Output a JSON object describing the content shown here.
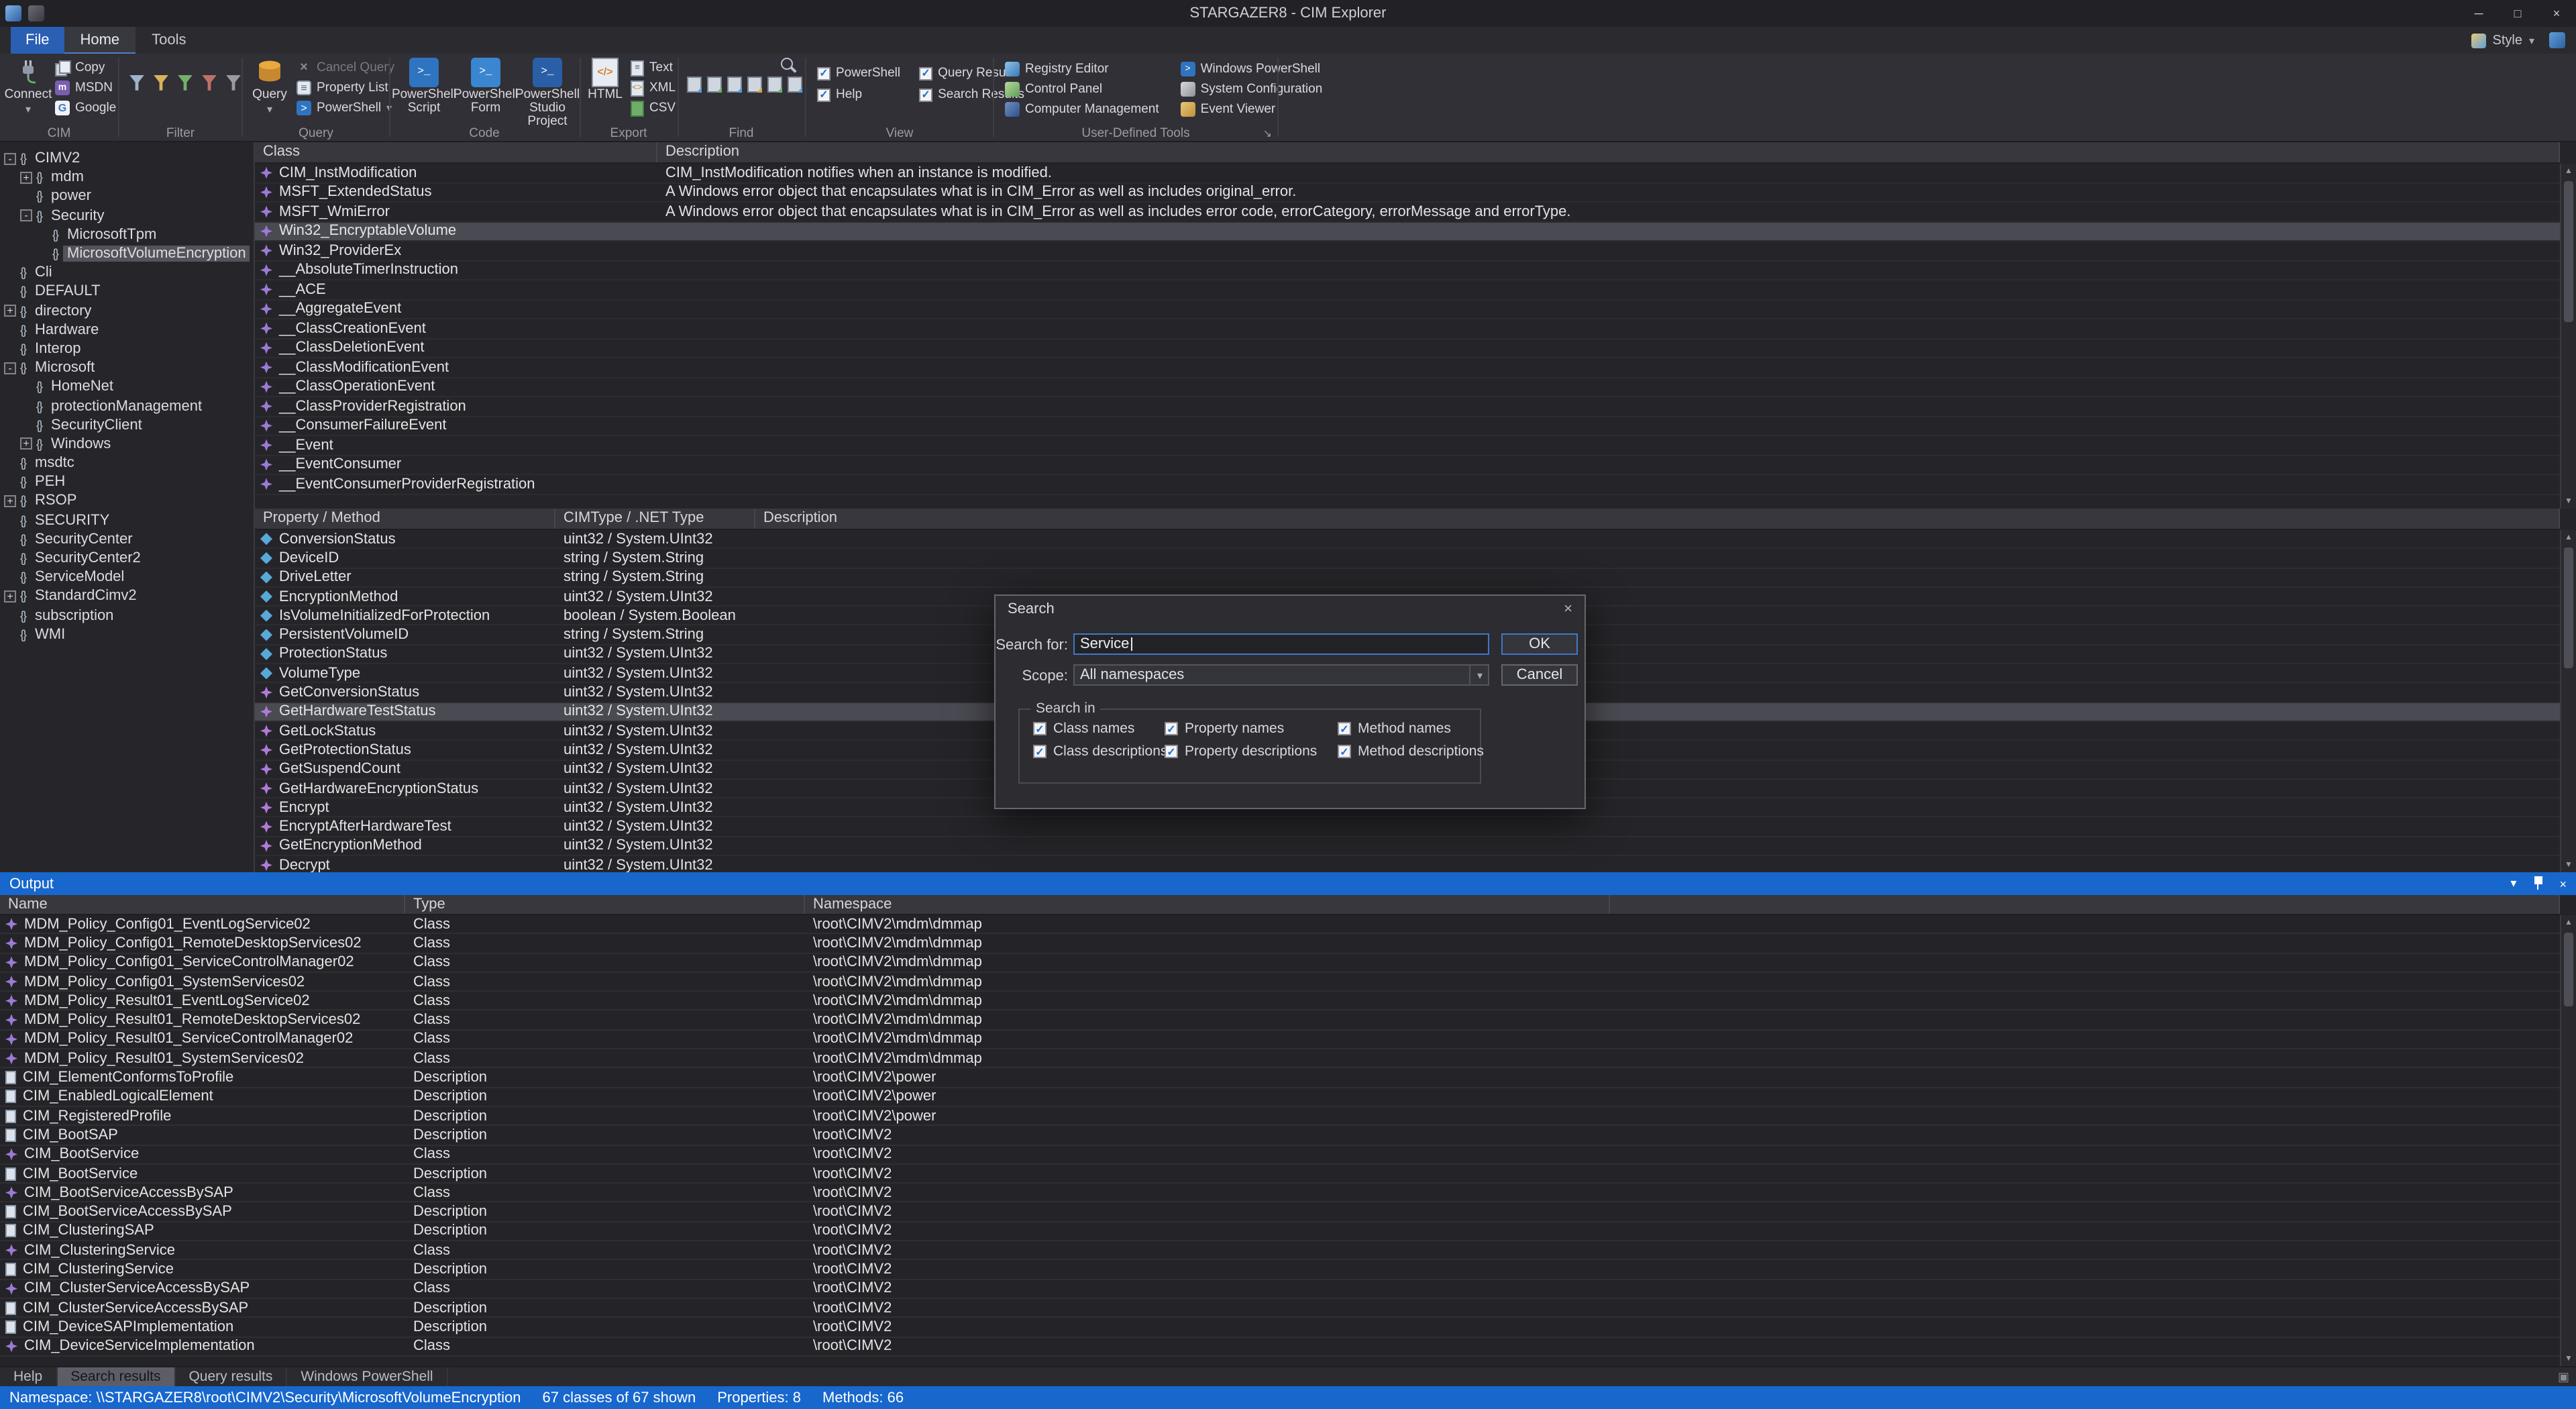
{
  "icons": {
    "minimize": "─",
    "maximize": "□",
    "close": "×",
    "dropdown": "▾",
    "check": "✓",
    "namespace_braces": "{}",
    "scroll_up": "▲",
    "scroll_down": "▼",
    "launcher": "↘",
    "panel_icon": "▣"
  },
  "titlebar": {
    "title": "STARGAZER8 - CIM Explorer"
  },
  "ribbon": {
    "tabs": [
      {
        "label": "File"
      },
      {
        "label": "Home"
      },
      {
        "label": "Tools"
      }
    ],
    "active_tab": "Home",
    "style_label": "Style",
    "group_labels": [
      "CIM",
      "Filter",
      "Query",
      "Code",
      "Export",
      "Find",
      "View",
      "User-Defined Tools"
    ],
    "cim": {
      "connect": "Connect",
      "copy": "Copy",
      "msdn": "MSDN",
      "google": "Google"
    },
    "query": {
      "query": "Query",
      "cancel_query": "Cancel Query",
      "property_list": "Property List",
      "powershell": "PowerShell"
    },
    "code": {
      "items": [
        "PowerShell Script",
        "PowerShell Form",
        "PowerShell Studio Project"
      ]
    },
    "export": {
      "html": "HTML",
      "text": "Text",
      "xml": "XML",
      "csv": "CSV"
    },
    "view": {
      "items": [
        {
          "label": "PowerShell",
          "checked": true
        },
        {
          "label": "Help",
          "checked": true
        },
        {
          "label": "Query Results",
          "checked": true
        },
        {
          "label": "Search Results",
          "checked": true
        }
      ]
    },
    "user_tools": {
      "col1": [
        "Registry Editor",
        "Control Panel",
        "Computer Management"
      ],
      "col2": [
        "Windows PowerShell",
        "System Configuration",
        "Event Viewer"
      ]
    }
  },
  "tree": {
    "items": [
      {
        "label": "CIMV2",
        "level": 0,
        "expand": "-"
      },
      {
        "label": "mdm",
        "level": 1,
        "expand": "+"
      },
      {
        "label": "power",
        "level": 1
      },
      {
        "label": "Security",
        "level": 1,
        "expand": "-"
      },
      {
        "label": "MicrosoftTpm",
        "level": 2
      },
      {
        "label": "MicrosoftVolumeEncryption",
        "level": 2,
        "selected": true
      },
      {
        "label": "Cli",
        "level": 0
      },
      {
        "label": "DEFAULT",
        "level": 0
      },
      {
        "label": "directory",
        "level": 0,
        "expand": "+"
      },
      {
        "label": "Hardware",
        "level": 0
      },
      {
        "label": "Interop",
        "level": 0
      },
      {
        "label": "Microsoft",
        "level": 0,
        "expand": "-"
      },
      {
        "label": "HomeNet",
        "level": 1
      },
      {
        "label": "protectionManagement",
        "level": 1
      },
      {
        "label": "SecurityClient",
        "level": 1
      },
      {
        "label": "Windows",
        "level": 1,
        "expand": "+"
      },
      {
        "label": "msdtc",
        "level": 0
      },
      {
        "label": "PEH",
        "level": 0
      },
      {
        "label": "RSOP",
        "level": 0,
        "expand": "+"
      },
      {
        "label": "SECURITY",
        "level": 0
      },
      {
        "label": "SecurityCenter",
        "level": 0
      },
      {
        "label": "SecurityCenter2",
        "level": 0
      },
      {
        "label": "ServiceModel",
        "level": 0
      },
      {
        "label": "StandardCimv2",
        "level": 0,
        "expand": "+"
      },
      {
        "label": "subscription",
        "level": 0
      },
      {
        "label": "WMI",
        "level": 0
      }
    ]
  },
  "class_list": {
    "columns": [
      "Class",
      "Description"
    ],
    "rows": [
      {
        "name": "CIM_InstModification",
        "desc": "CIM_InstModification notifies when an instance is modified."
      },
      {
        "name": "MSFT_ExtendedStatus",
        "desc": "A Windows error object that encapsulates what is in CIM_Error as well as includes original_error."
      },
      {
        "name": "MSFT_WmiError",
        "desc": "A Windows error object that encapsulates what is in CIM_Error as well as includes error code, errorCategory, errorMessage and errorType."
      },
      {
        "name": "Win32_EncryptableVolume",
        "desc": "",
        "selected": true
      },
      {
        "name": "Win32_ProviderEx",
        "desc": ""
      },
      {
        "name": "__AbsoluteTimerInstruction",
        "desc": ""
      },
      {
        "name": "__ACE",
        "desc": ""
      },
      {
        "name": "__AggregateEvent",
        "desc": ""
      },
      {
        "name": "__ClassCreationEvent",
        "desc": ""
      },
      {
        "name": "__ClassDeletionEvent",
        "desc": ""
      },
      {
        "name": "__ClassModificationEvent",
        "desc": ""
      },
      {
        "name": "__ClassOperationEvent",
        "desc": ""
      },
      {
        "name": "__ClassProviderRegistration",
        "desc": ""
      },
      {
        "name": "__ConsumerFailureEvent",
        "desc": ""
      },
      {
        "name": "__Event",
        "desc": ""
      },
      {
        "name": "__EventConsumer",
        "desc": ""
      },
      {
        "name": "__EventConsumerProviderRegistration",
        "desc": ""
      }
    ]
  },
  "property_list": {
    "columns": [
      "Property / Method",
      "CIMType / .NET Type",
      "Description"
    ],
    "rows": [
      {
        "name": "ConversionStatus",
        "type": "uint32 / System.UInt32",
        "kind": "property"
      },
      {
        "name": "DeviceID",
        "type": "string / System.String",
        "kind": "property"
      },
      {
        "name": "DriveLetter",
        "type": "string / System.String",
        "kind": "property"
      },
      {
        "name": "EncryptionMethod",
        "type": "uint32 / System.UInt32",
        "kind": "property"
      },
      {
        "name": "IsVolumeInitializedForProtection",
        "type": "boolean / System.Boolean",
        "kind": "property"
      },
      {
        "name": "PersistentVolumeID",
        "type": "string / System.String",
        "kind": "property"
      },
      {
        "name": "ProtectionStatus",
        "type": "uint32 / System.UInt32",
        "kind": "property"
      },
      {
        "name": "VolumeType",
        "type": "uint32 / System.UInt32",
        "kind": "property"
      },
      {
        "name": "GetConversionStatus",
        "type": "uint32 / System.UInt32",
        "kind": "method"
      },
      {
        "name": "GetHardwareTestStatus",
        "type": "uint32 / System.UInt32",
        "kind": "method",
        "selected": true
      },
      {
        "name": "GetLockStatus",
        "type": "uint32 / System.UInt32",
        "kind": "method"
      },
      {
        "name": "GetProtectionStatus",
        "type": "uint32 / System.UInt32",
        "kind": "method"
      },
      {
        "name": "GetSuspendCount",
        "type": "uint32 / System.UInt32",
        "kind": "method"
      },
      {
        "name": "GetHardwareEncryptionStatus",
        "type": "uint32 / System.UInt32",
        "kind": "method"
      },
      {
        "name": "Encrypt",
        "type": "uint32 / System.UInt32",
        "kind": "method"
      },
      {
        "name": "EncryptAfterHardwareTest",
        "type": "uint32 / System.UInt32",
        "kind": "method"
      },
      {
        "name": "GetEncryptionMethod",
        "type": "uint32 / System.UInt32",
        "kind": "method"
      },
      {
        "name": "Decrypt",
        "type": "uint32 / System.UInt32",
        "kind": "method"
      }
    ]
  },
  "search_dialog": {
    "title": "Search",
    "search_for_label": "Search for:",
    "search_value": "Service",
    "ok_label": "OK",
    "scope_label": "Scope:",
    "scope_value": "All namespaces",
    "cancel_label": "Cancel",
    "search_in_label": "Search in",
    "checkbox_rows": [
      [
        {
          "label": "Class names",
          "checked": true
        },
        {
          "label": "Property names",
          "checked": true
        },
        {
          "label": "Method names",
          "checked": true
        }
      ],
      [
        {
          "label": "Class descriptions",
          "checked": true
        },
        {
          "label": "Property descriptions",
          "checked": true
        },
        {
          "label": "Method descriptions",
          "checked": true
        }
      ]
    ]
  },
  "output": {
    "title": "Output",
    "columns": [
      "Name",
      "Type",
      "Namespace"
    ],
    "rows": [
      {
        "name": "MDM_Policy_Config01_EventLogService02",
        "type": "Class",
        "ns": "\\root\\CIMV2\\mdm\\dmmap"
      },
      {
        "name": "MDM_Policy_Config01_RemoteDesktopServices02",
        "type": "Class",
        "ns": "\\root\\CIMV2\\mdm\\dmmap"
      },
      {
        "name": "MDM_Policy_Config01_ServiceControlManager02",
        "type": "Class",
        "ns": "\\root\\CIMV2\\mdm\\dmmap"
      },
      {
        "name": "MDM_Policy_Config01_SystemServices02",
        "type": "Class",
        "ns": "\\root\\CIMV2\\mdm\\dmmap"
      },
      {
        "name": "MDM_Policy_Result01_EventLogService02",
        "type": "Class",
        "ns": "\\root\\CIMV2\\mdm\\dmmap"
      },
      {
        "name": "MDM_Policy_Result01_RemoteDesktopServices02",
        "type": "Class",
        "ns": "\\root\\CIMV2\\mdm\\dmmap"
      },
      {
        "name": "MDM_Policy_Result01_ServiceControlManager02",
        "type": "Class",
        "ns": "\\root\\CIMV2\\mdm\\dmmap"
      },
      {
        "name": "MDM_Policy_Result01_SystemServices02",
        "type": "Class",
        "ns": "\\root\\CIMV2\\mdm\\dmmap"
      },
      {
        "name": "CIM_ElementConformsToProfile",
        "type": "Description",
        "ns": "\\root\\CIMV2\\power"
      },
      {
        "name": "CIM_EnabledLogicalElement",
        "type": "Description",
        "ns": "\\root\\CIMV2\\power"
      },
      {
        "name": "CIM_RegisteredProfile",
        "type": "Description",
        "ns": "\\root\\CIMV2\\power"
      },
      {
        "name": "CIM_BootSAP",
        "type": "Description",
        "ns": "\\root\\CIMV2"
      },
      {
        "name": "CIM_BootService",
        "type": "Class",
        "ns": "\\root\\CIMV2"
      },
      {
        "name": "CIM_BootService",
        "type": "Description",
        "ns": "\\root\\CIMV2"
      },
      {
        "name": "CIM_BootServiceAccessBySAP",
        "type": "Class",
        "ns": "\\root\\CIMV2"
      },
      {
        "name": "CIM_BootServiceAccessBySAP",
        "type": "Description",
        "ns": "\\root\\CIMV2"
      },
      {
        "name": "CIM_ClusteringSAP",
        "type": "Description",
        "ns": "\\root\\CIMV2"
      },
      {
        "name": "CIM_ClusteringService",
        "type": "Class",
        "ns": "\\root\\CIMV2"
      },
      {
        "name": "CIM_ClusteringService",
        "type": "Description",
        "ns": "\\root\\CIMV2"
      },
      {
        "name": "CIM_ClusterServiceAccessBySAP",
        "type": "Class",
        "ns": "\\root\\CIMV2"
      },
      {
        "name": "CIM_ClusterServiceAccessBySAP",
        "type": "Description",
        "ns": "\\root\\CIMV2"
      },
      {
        "name": "CIM_DeviceSAPImplementation",
        "type": "Description",
        "ns": "\\root\\CIMV2"
      },
      {
        "name": "CIM_DeviceServiceImplementation",
        "type": "Class",
        "ns": "\\root\\CIMV2"
      }
    ]
  },
  "bottom_tabs": {
    "items": [
      "Help",
      "Search results",
      "Query results",
      "Windows PowerShell"
    ],
    "active": "Search results"
  },
  "statusbar": {
    "namespace": "Namespace: \\\\STARGAZER8\\root\\CIMV2\\Security\\MicrosoftVolumeEncryption",
    "classes_shown": "67 classes of 67 shown",
    "properties": "Properties: 8",
    "methods": "Methods: 66"
  }
}
